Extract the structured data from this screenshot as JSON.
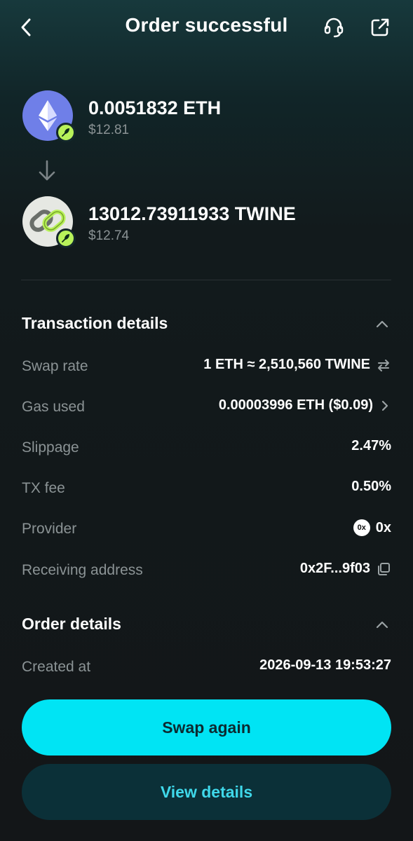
{
  "header": {
    "title": "Order successful"
  },
  "swap": {
    "from": {
      "amount": "0.0051832 ETH",
      "usd": "$12.81",
      "icon": "ethereum-icon"
    },
    "to": {
      "amount": "13012.73911933 TWINE",
      "usd": "$12.74",
      "icon": "twine-chain-icon"
    }
  },
  "transaction_details": {
    "title": "Transaction details",
    "rows": [
      {
        "label": "Swap rate",
        "value": "1 ETH ≈ 2,510,560 TWINE"
      },
      {
        "label": "Gas used",
        "value": "0.00003996 ETH ($0.09)"
      },
      {
        "label": "Slippage",
        "value": "2.47%"
      },
      {
        "label": "TX fee",
        "value": "0.50%"
      },
      {
        "label": "Provider",
        "value": "0x",
        "logo_text": "0x"
      },
      {
        "label": "Receiving address",
        "value": "0x2F...9f03"
      }
    ]
  },
  "order_details": {
    "title": "Order details",
    "rows": [
      {
        "label": "Created at",
        "value": "2026-09-13 19:53:27"
      }
    ]
  },
  "buttons": {
    "primary": "Swap again",
    "secondary": "View details"
  },
  "colors": {
    "accent": "#00e4f4",
    "badge": "#b8f25a",
    "eth": "#6f7fe8"
  }
}
